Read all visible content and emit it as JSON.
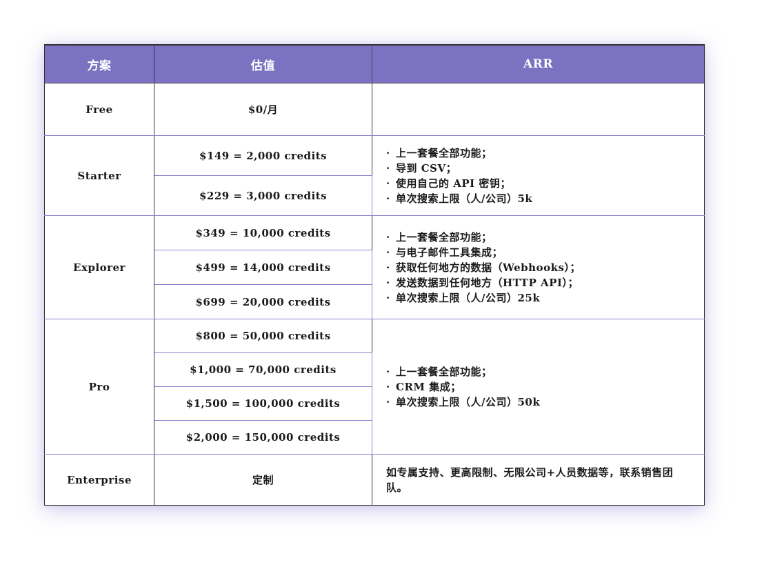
{
  "headers": [
    "方案",
    "估值",
    "ARR"
  ],
  "free": {
    "plan": "Free",
    "price": "$0/月"
  },
  "starter": {
    "plan": "Starter",
    "prices": [
      "$149 = 2,000 credits",
      "$229 = 3,000 credits"
    ],
    "features": [
      "上一套餐全部功能；",
      "导到 CSV；",
      "使用自己的 API 密钥；",
      "单次搜索上限（人/公司）5k"
    ]
  },
  "explorer": {
    "plan": "Explorer",
    "prices": [
      "$349 = 10,000 credits",
      "$499 = 14,000 credits",
      "$699 = 20,000 credits"
    ],
    "features": [
      "上一套餐全部功能；",
      "与电子邮件工具集成；",
      "获取任何地方的数据（Webhooks）；",
      "发送数据到任何地方（HTTP API）；",
      "单次搜索上限（人/公司）25k"
    ]
  },
  "pro": {
    "plan": "Pro",
    "prices": [
      "$800 = 50,000 credits",
      "$1,000 = 70,000 credits",
      "$1,500 = 100,000 credits",
      "$2,000 = 150,000 credits"
    ],
    "features": [
      "上一套餐全部功能；",
      "CRM 集成；",
      "单次搜索上限（人/公司）50k"
    ]
  },
  "enterprise": {
    "plan": "Enterprise",
    "price": "定制",
    "note": "如专属支持、更高限制、无限公司+人员数据等，联系销售团队。"
  },
  "bullet": "·"
}
